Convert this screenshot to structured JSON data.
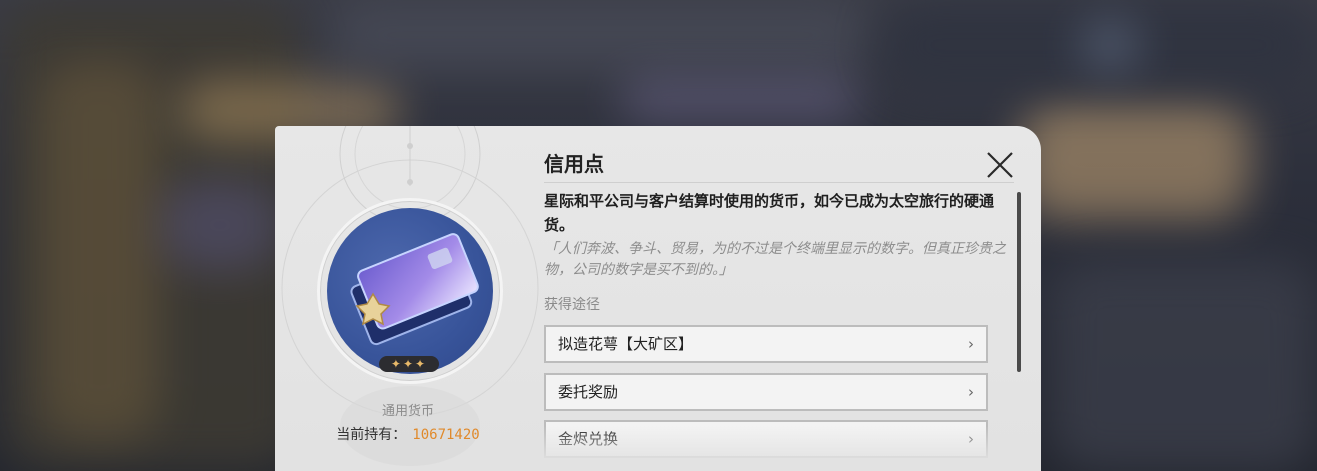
{
  "item": {
    "name": "信用点",
    "description": "星际和平公司与客户结算时使用的货币，如今已成为太空旅行的硬通货。",
    "quote": "「人们奔波、争斗、贸易，为的不过是个终端里显示的数字。但真正珍贵之物，公司的数字是买不到的。」",
    "rarity_stars": "✦✦✦",
    "category": "通用货币",
    "owned_label": "当前持有：",
    "owned_value": "10671420"
  },
  "sources": {
    "label": "获得途径",
    "items": [
      {
        "label": "拟造花萼【大矿区】",
        "chevron": "›"
      },
      {
        "label": "委托奖励",
        "chevron": "›"
      },
      {
        "label": "金烬兑换",
        "chevron": "›"
      }
    ]
  },
  "icons": {
    "close": "close-icon",
    "chevron": "chevron-right-icon",
    "item": "credit-card-icon"
  },
  "colors": {
    "card_bg": "#e4e4e4",
    "medal_blue": "#3b579c",
    "owned_value": "#e08a2c",
    "star_gold": "#e8b96a"
  }
}
